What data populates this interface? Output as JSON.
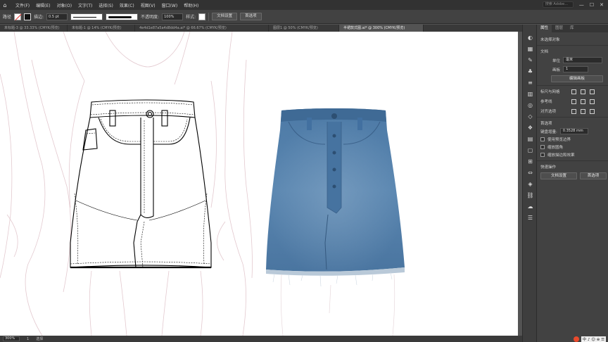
{
  "menubar": {
    "logo": "⌂",
    "items": [
      "文件(F)",
      "编辑(E)",
      "对象(O)",
      "文字(T)",
      "选择(S)",
      "效果(C)",
      "视图(V)",
      "窗口(W)",
      "帮助(H)"
    ],
    "search_placeholder": "搜索 Adobe...",
    "window_buttons": [
      "—",
      "☐",
      "✕"
    ]
  },
  "controlbar": {
    "selection_label": "路径",
    "stroke_label": "描边:",
    "stroke_value": "0.5 pt",
    "profile_label": "等比",
    "brush_label": "基本",
    "opacity_label": "不透明度:",
    "opacity_value": "100%",
    "style_label": "样式:",
    "doc_setup_button": "文档设置",
    "prefs_button": "首选项"
  },
  "tabs": [
    {
      "label": "未标题-3 @ 33.33% (CMYK/预览)",
      "active": false
    },
    {
      "label": "未标题-1 @ 14% (CMYK/预览)",
      "active": false
    },
    {
      "label": "4e4d1e87a5a4d8dd4a.ai* @ 66.67% (CMYK/预览)",
      "active": false
    },
    {
      "label": "图层1 @ 50% (CMYK/预览)",
      "active": false
    },
    {
      "label": "半裙款式图.ai* @ 300% (CMYK/预览)",
      "active": true
    }
  ],
  "statusbar": {
    "zoom": "300%",
    "page": "1",
    "tool": "选择"
  },
  "dock": {
    "icons": [
      "color-icon",
      "swatches-icon",
      "brush-icon",
      "symbol-icon",
      "stroke-icon",
      "gradient-icon",
      "transparency-icon",
      "appearance-icon",
      "graphic-styles-icon",
      "layers-icon",
      "artboards-icon",
      "align-icon",
      "transform-icon",
      "pathfinder-icon",
      "links-icon",
      "libraries-icon",
      "properties-icon"
    ],
    "glyphs": [
      "◐",
      "▦",
      "✎",
      "♣",
      "≡",
      "▥",
      "◎",
      "◇",
      "❖",
      "▤",
      "▢",
      "⊞",
      "⇔",
      "◈",
      "⛓",
      "☁",
      "☰"
    ]
  },
  "panel": {
    "tabs": [
      "属性",
      "图层",
      "库"
    ],
    "no_selection": "未选择对象",
    "doc_section": "文档",
    "unit_label": "单位",
    "unit_value": "毫米",
    "artboard_label": "画板",
    "artboard_value": "1",
    "edit_artboard_button": "编辑画板",
    "ruler_grid_section": "标尺与网格",
    "guides_section": "参考线",
    "snap_section": "对齐选项",
    "preferences_section": "首选项",
    "keyboard_increment_label": "键盘增量:",
    "keyboard_increment_value": "0.3528 mm",
    "check_preview_bounds": "使用预览边界",
    "check_scale_corners": "缩放圆角",
    "check_scale_strokes": "缩放描边和效果",
    "quick_actions_section": "快速操作",
    "doc_setup_button": "文档设置",
    "prefs_button": "首选项"
  },
  "watermark": {
    "text": "中 ♪ ☺ ⊕ ☰"
  }
}
